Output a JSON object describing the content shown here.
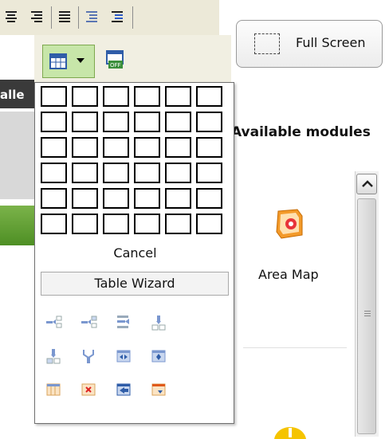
{
  "toolbar": {
    "icons": [
      "align-center-icon",
      "align-right-icon",
      "align-justify-icon",
      "decrease-indent-icon",
      "increase-indent-icon",
      "checkbox-icon",
      "table-icon",
      "dropdown-arrow-icon",
      "table-properties-icon"
    ]
  },
  "sidebar": {
    "partial_label": "alle"
  },
  "table_popup": {
    "grid_rows": 6,
    "grid_cols": 6,
    "cancel_label": "Cancel",
    "wizard_label": "Table Wizard",
    "operation_icons": [
      "insert-row-before-icon",
      "insert-row-after-icon",
      "insert-column-after-icon",
      "insert-column-before-icon",
      "insert-cell-icon",
      "merge-cells-icon",
      "split-cells-icon",
      "cell-properties-icon",
      "row-properties-icon",
      "delete-table-icon",
      "delete-cell-icon",
      "table-settings-icon"
    ]
  },
  "fullscreen_button": {
    "label": "Full Screen"
  },
  "modules": {
    "header": "Available modules",
    "items": [
      {
        "label": "Area Map",
        "icon": "area-map-icon"
      }
    ]
  },
  "colors": {
    "accent_green": "#7bb34a",
    "table_button_bg": "#c7e6a9",
    "area_map_orange": "#f39a2a"
  }
}
